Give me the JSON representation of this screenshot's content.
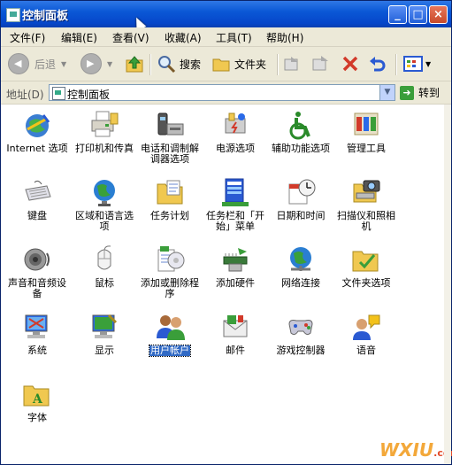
{
  "window": {
    "title": "控制面板"
  },
  "menu": [
    "文件(F)",
    "编辑(E)",
    "查看(V)",
    "收藏(A)",
    "工具(T)",
    "帮助(H)"
  ],
  "toolbar": {
    "back": "后退",
    "search": "搜索",
    "folders": "文件夹"
  },
  "address": {
    "label": "地址(D)",
    "value": "控制面板",
    "go": "转到"
  },
  "items": [
    {
      "label": "Internet 选项",
      "icon": "internet-options-icon"
    },
    {
      "label": "打印机和传真",
      "icon": "printer-fax-icon"
    },
    {
      "label": "电话和调制解调器选项",
      "icon": "phone-modem-icon"
    },
    {
      "label": "电源选项",
      "icon": "power-options-icon"
    },
    {
      "label": "辅助功能选项",
      "icon": "accessibility-icon"
    },
    {
      "label": "管理工具",
      "icon": "admin-tools-icon"
    },
    {
      "label": "键盘",
      "icon": "keyboard-icon"
    },
    {
      "label": "区域和语言选项",
      "icon": "region-language-icon"
    },
    {
      "label": "任务计划",
      "icon": "scheduled-tasks-icon"
    },
    {
      "label": "任务栏和「开始」菜单",
      "icon": "taskbar-start-icon"
    },
    {
      "label": "日期和时间",
      "icon": "date-time-icon"
    },
    {
      "label": "扫描仪和照相机",
      "icon": "scanner-camera-icon"
    },
    {
      "label": "声音和音频设备",
      "icon": "sound-audio-icon"
    },
    {
      "label": "鼠标",
      "icon": "mouse-icon"
    },
    {
      "label": "添加或删除程序",
      "icon": "add-remove-programs-icon"
    },
    {
      "label": "添加硬件",
      "icon": "add-hardware-icon"
    },
    {
      "label": "网络连接",
      "icon": "network-connections-icon"
    },
    {
      "label": "文件夹选项",
      "icon": "folder-options-icon"
    },
    {
      "label": "系统",
      "icon": "system-icon"
    },
    {
      "label": "显示",
      "icon": "display-icon"
    },
    {
      "label": "用户帐户",
      "icon": "user-accounts-icon",
      "selected": true
    },
    {
      "label": "邮件",
      "icon": "mail-icon"
    },
    {
      "label": "游戏控制器",
      "icon": "game-controllers-icon"
    },
    {
      "label": "语音",
      "icon": "speech-icon"
    },
    {
      "label": "字体",
      "icon": "fonts-icon"
    }
  ],
  "watermark": {
    "main": "WXIU",
    "suffix": ".com"
  }
}
